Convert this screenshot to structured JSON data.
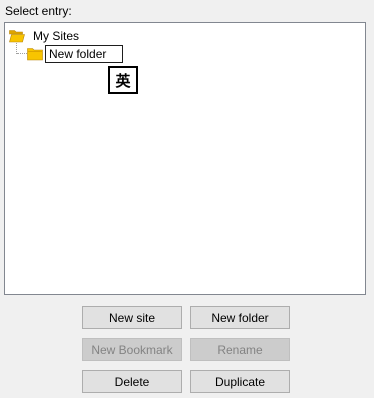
{
  "labels": {
    "select_entry": "Select entry:"
  },
  "tree": {
    "root": {
      "label": "My Sites",
      "icon": "folder-open-icon"
    },
    "child": {
      "icon": "folder-icon",
      "edit_value": "New folder"
    }
  },
  "ime": {
    "glyph": "英"
  },
  "buttons": {
    "new_site": "New site",
    "new_folder": "New folder",
    "new_bookmark": "New Bookmark",
    "rename": "Rename",
    "delete": "Delete",
    "duplicate": "Duplicate"
  },
  "colors": {
    "folder_yellow": "#f8c400",
    "folder_dark": "#dea500"
  }
}
